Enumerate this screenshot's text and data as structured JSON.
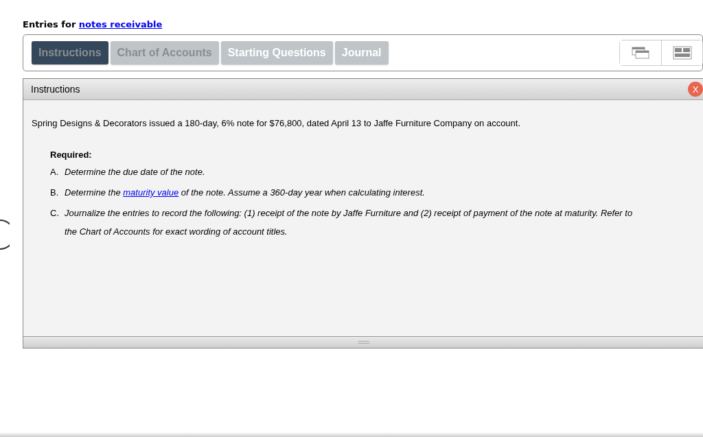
{
  "heading": {
    "text": "Entries for ",
    "link": "notes receivable"
  },
  "tabs": [
    {
      "label": "Instructions",
      "selected": true,
      "disabled": false
    },
    {
      "label": "Chart of Accounts",
      "selected": false,
      "disabled": true
    },
    {
      "label": "Starting Questions",
      "selected": false,
      "disabled": false
    },
    {
      "label": "Journal",
      "selected": false,
      "disabled": false
    }
  ],
  "panel": {
    "title": "Instructions",
    "close": "X",
    "intro": "Spring Designs & Decorators issued a 180-day, 6% note for $76,800, dated April 13 to Jaffe Furniture Company on account.",
    "required_label": "Required:",
    "items": [
      {
        "marker": "A.",
        "before": "Determine the due date of the note."
      },
      {
        "marker": "B.",
        "before": "Determine the ",
        "link": "maturity value",
        "after": " of the note. Assume a 360-day year when calculating interest."
      },
      {
        "marker": "C.",
        "before": "Journalize the entries to record the following: (1) receipt of the note by Jaffe Furniture and (2) receipt of payment of the note at maturity. Refer to the Chart of Accounts for exact wording of account titles."
      }
    ]
  }
}
